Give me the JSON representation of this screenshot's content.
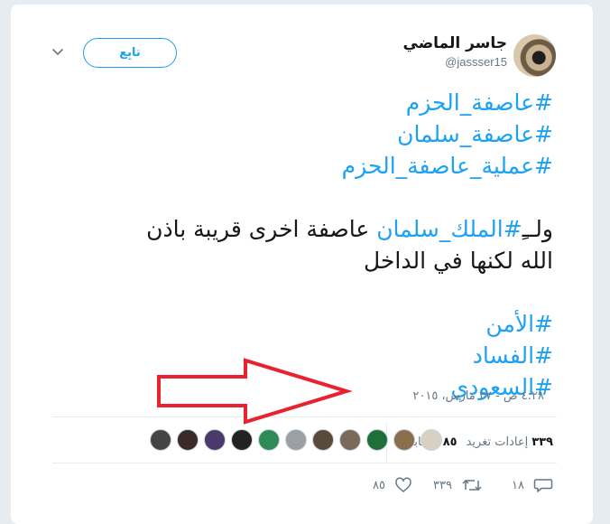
{
  "author": {
    "display_name": "جاسر الماضي",
    "handle": "@jassser15"
  },
  "header": {
    "follow_label": "تابِع",
    "menu_icon": "chevron-down-icon"
  },
  "tweet": {
    "hashtags_top": [
      "#عاصفة_الحزم",
      "#عاصفة_سلمان",
      "#عملية_عاصفة_الحزم"
    ],
    "body_prefix": "ولــِ",
    "body_hashtag": "#الملك_سلمان",
    "body_suffix": " عاصفة اخرى قريبة باذن",
    "body_line2": "الله لكنها في الداخل",
    "hashtags_bottom": [
      "#الأمن",
      "#الفساد",
      "#السعودي"
    ],
    "timestamp": "٤:٢٨ ص - ٢٧ مارس، ٢٠١٥"
  },
  "stats": {
    "retweets_count": "٣٣٩",
    "retweets_label": "إعادات تغريد",
    "likes_count": "٨٥",
    "likes_label": "إعجابات"
  },
  "likers": [
    {
      "color": "#d8d0c0"
    },
    {
      "color": "#8a6f4a"
    },
    {
      "color": "#1f6f3a"
    },
    {
      "color": "#7a6a5a"
    },
    {
      "color": "#5a4a3a"
    },
    {
      "color": "#9aa0a6"
    },
    {
      "color": "#2e8b57"
    },
    {
      "color": "#222222"
    },
    {
      "color": "#4a3a6a"
    },
    {
      "color": "#3a2a2a"
    },
    {
      "color": "#444444"
    }
  ],
  "actions": {
    "reply_count": "١٨",
    "retweet_count": "٣٣٩",
    "like_count": "٨٥",
    "reply_icon": "reply-icon",
    "retweet_icon": "retweet-icon",
    "like_icon": "heart-icon"
  },
  "colors": {
    "accent": "#1da1f2",
    "text": "#14171a",
    "secondary": "#657786",
    "annotation_arrow": "#e8232f"
  }
}
